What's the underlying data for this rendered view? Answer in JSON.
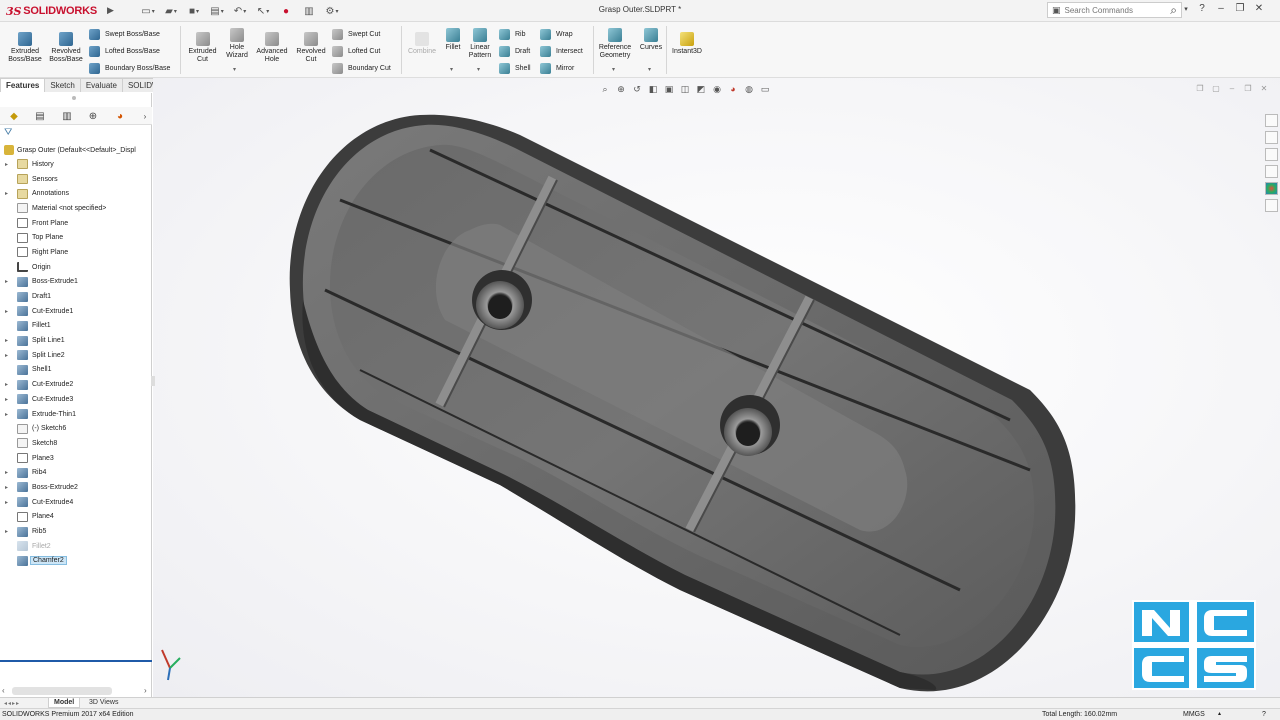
{
  "app": {
    "brand": "SOLIDWORKS",
    "document_title": "Grasp Outer.SLDPRT *"
  },
  "search": {
    "placeholder": "Search Commands"
  },
  "ribbon": {
    "extruded_boss": "Extruded Boss/Base",
    "revolved_boss": "Revolved Boss/Base",
    "swept_boss": "Swept Boss/Base",
    "lofted_boss": "Lofted Boss/Base",
    "boundary_boss": "Boundary Boss/Base",
    "extruded_cut": "Extruded Cut",
    "hole_wizard": "Hole Wizard",
    "advanced_hole": "Advanced Hole",
    "revolved_cut": "Revolved Cut",
    "swept_cut": "Swept Cut",
    "lofted_cut": "Lofted Cut",
    "boundary_cut": "Boundary Cut",
    "combine": "Combine",
    "fillet": "Fillet",
    "linear_pattern": "Linear Pattern",
    "rib": "Rib",
    "draft": "Draft",
    "shell": "Shell",
    "wrap": "Wrap",
    "intersect": "Intersect",
    "mirror": "Mirror",
    "reference_geometry": "Reference Geometry",
    "curves": "Curves",
    "instant3d": "Instant3D"
  },
  "tabs": [
    "Features",
    "Sketch",
    "Evaluate",
    "SOLIDWORKS Add-Ins"
  ],
  "feature_tree": {
    "root": "Grasp Outer  (Default<<Default>_Displ",
    "items": [
      {
        "label": "History",
        "icon": "folder",
        "expand": true
      },
      {
        "label": "Sensors",
        "icon": "folder",
        "expand": false
      },
      {
        "label": "Annotations",
        "icon": "folder",
        "expand": true
      },
      {
        "label": "Material <not specified>",
        "icon": "sketch",
        "expand": false
      },
      {
        "label": "Front Plane",
        "icon": "plane",
        "expand": false
      },
      {
        "label": "Top Plane",
        "icon": "plane",
        "expand": false
      },
      {
        "label": "Right Plane",
        "icon": "plane",
        "expand": false
      },
      {
        "label": "Origin",
        "icon": "origin",
        "expand": false
      },
      {
        "label": "Boss-Extrude1",
        "icon": "feat",
        "expand": true
      },
      {
        "label": "Draft1",
        "icon": "feat",
        "expand": false
      },
      {
        "label": "Cut-Extrude1",
        "icon": "feat",
        "expand": true
      },
      {
        "label": "Fillet1",
        "icon": "feat",
        "expand": false
      },
      {
        "label": "Split Line1",
        "icon": "feat",
        "expand": true
      },
      {
        "label": "Split Line2",
        "icon": "feat",
        "expand": true
      },
      {
        "label": "Shell1",
        "icon": "feat",
        "expand": false
      },
      {
        "label": "Cut-Extrude2",
        "icon": "feat",
        "expand": true
      },
      {
        "label": "Cut-Extrude3",
        "icon": "feat",
        "expand": true
      },
      {
        "label": "Extrude-Thin1",
        "icon": "feat",
        "expand": true
      },
      {
        "label": "(-) Sketch6",
        "icon": "sketch",
        "expand": false
      },
      {
        "label": "Sketch8",
        "icon": "sketch",
        "expand": false
      },
      {
        "label": "Plane3",
        "icon": "plane",
        "expand": false
      },
      {
        "label": "Rib4",
        "icon": "feat",
        "expand": true
      },
      {
        "label": "Boss-Extrude2",
        "icon": "feat",
        "expand": true
      },
      {
        "label": "Cut-Extrude4",
        "icon": "feat",
        "expand": true
      },
      {
        "label": "Plane4",
        "icon": "plane",
        "expand": false
      },
      {
        "label": "Rib5",
        "icon": "feat",
        "expand": true
      },
      {
        "label": "Fillet2",
        "icon": "feat",
        "expand": false,
        "suppressed": true
      },
      {
        "label": "Chamfer2",
        "icon": "feat",
        "expand": false,
        "selected": true
      }
    ]
  },
  "bottom_tabs": [
    "Model",
    "3D Views"
  ],
  "status": {
    "edition": "SOLIDWORKS Premium 2017 x64 Edition",
    "total_length": "Total Length: 160.02mm",
    "units": "MMGS"
  },
  "watermark": {
    "text": "NCCS"
  },
  "colors": {
    "brand_red": "#c8102e",
    "selection_blue": "#1f5aa8",
    "part_gray": "#6b6b6b",
    "ncs_blue": "#2aa7e0"
  }
}
